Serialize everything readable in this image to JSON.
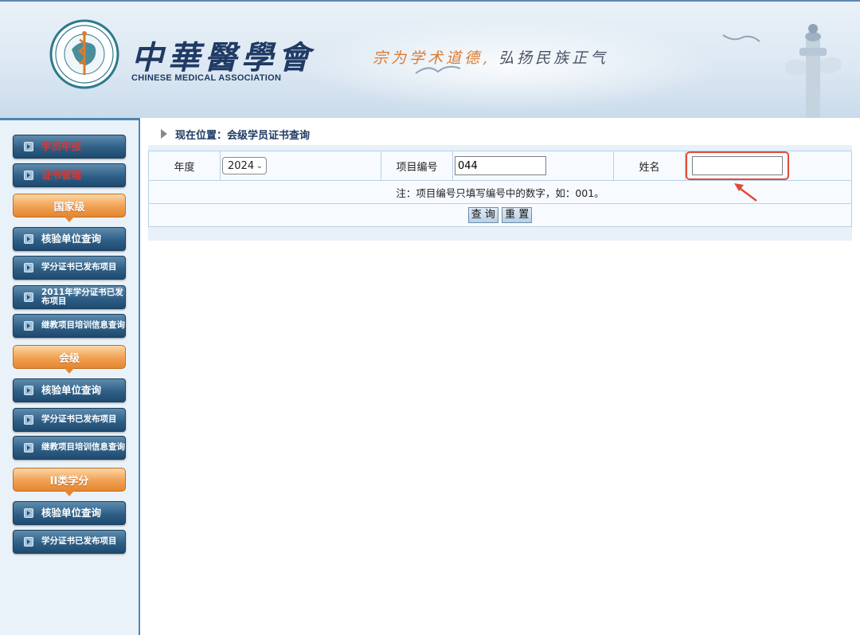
{
  "header": {
    "brand_cn": "中華醫學會",
    "brand_en": "CHINESE MEDICAL ASSOCIATION",
    "motto_part1": "宗为学术道德,",
    "motto_part2": "弘扬民族正气"
  },
  "sidebar": {
    "items": [
      {
        "label": "学员申报",
        "kind": "nav",
        "red": true
      },
      {
        "label": "证书管理",
        "kind": "nav",
        "red": true
      },
      {
        "label": "国家级",
        "kind": "section"
      },
      {
        "label": "核验单位查询",
        "kind": "nav"
      },
      {
        "label": "学分证书已发布项目",
        "kind": "nav"
      },
      {
        "label": "2011年学分证书已发布项目",
        "kind": "nav"
      },
      {
        "label": "继教项目培训信息查询",
        "kind": "nav"
      },
      {
        "label": "会级",
        "kind": "section"
      },
      {
        "label": "核验单位查询",
        "kind": "nav"
      },
      {
        "label": "学分证书已发布项目",
        "kind": "nav"
      },
      {
        "label": "继教项目培训信息查询",
        "kind": "nav"
      },
      {
        "label": "II类学分",
        "kind": "section"
      },
      {
        "label": "核验单位查询",
        "kind": "nav"
      },
      {
        "label": "学分证书已发布项目",
        "kind": "nav"
      }
    ]
  },
  "main": {
    "breadcrumb": "现在位置：会级学员证书查询",
    "form": {
      "year_label": "年度",
      "year_value": "2024",
      "project_label": "项目编号",
      "project_value": "044",
      "name_label": "姓名",
      "name_value": ""
    },
    "note": "注：项目编号只填写编号中的数字，如：001。",
    "buttons": {
      "query": "查 询",
      "reset": "重 置"
    }
  },
  "colors": {
    "accent_blue": "#1f3a64",
    "nav_dark": "#2f5f86",
    "section_orange": "#f2a458",
    "note_red": "#d33a2c",
    "highlight_red": "#e14a37"
  }
}
